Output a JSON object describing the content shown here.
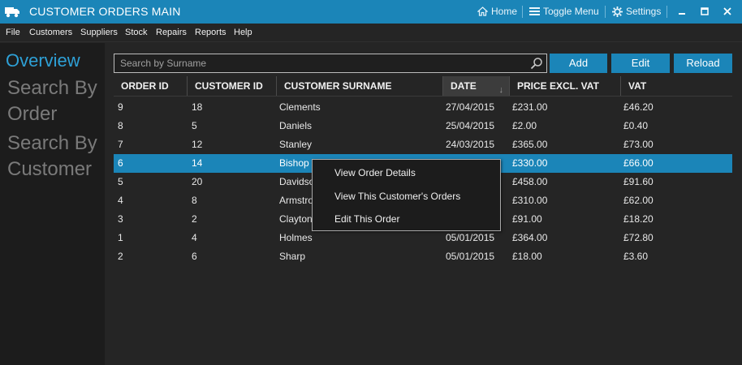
{
  "window": {
    "title": "CUSTOMER ORDERS MAIN",
    "home_label": "Home",
    "toggle_label": "Toggle Menu",
    "settings_label": "Settings"
  },
  "menu": [
    "File",
    "Customers",
    "Suppliers",
    "Stock",
    "Repairs",
    "Reports",
    "Help"
  ],
  "sidebar": {
    "overview": "Overview",
    "search_by_order": "Search By Order",
    "search_by_customer": "Search By Customer"
  },
  "search": {
    "placeholder": "Search by Surname",
    "value": ""
  },
  "buttons": {
    "add": "Add",
    "edit": "Edit",
    "reload": "Reload"
  },
  "table": {
    "columns": [
      "ORDER ID",
      "CUSTOMER ID",
      "CUSTOMER SURNAME",
      "DATE",
      "PRICE EXCL. VAT",
      "VAT"
    ],
    "sorted_column": "DATE",
    "sort_direction": "descending",
    "rows": [
      [
        "9",
        "18",
        "Clements",
        "27/04/2015",
        "£231.00",
        "£46.20"
      ],
      [
        "8",
        "5",
        "Daniels",
        "25/04/2015",
        "£2.00",
        "£0.40"
      ],
      [
        "7",
        "12",
        "Stanley",
        "24/03/2015",
        "£365.00",
        "£73.00"
      ],
      [
        "6",
        "14",
        "Bishop",
        "",
        "£330.00",
        "£66.00"
      ],
      [
        "5",
        "20",
        "Davidso",
        "",
        "£458.00",
        "£91.60"
      ],
      [
        "4",
        "8",
        "Armstro",
        "",
        "£310.00",
        "£62.00"
      ],
      [
        "3",
        "2",
        "Clayton",
        "",
        "£91.00",
        "£18.20"
      ],
      [
        "1",
        "4",
        "Holmes",
        "05/01/2015",
        "£364.00",
        "£72.80"
      ],
      [
        "2",
        "6",
        "Sharp",
        "05/01/2015",
        "£18.00",
        "£3.60"
      ]
    ],
    "selected_row_index": 3
  },
  "context_menu": {
    "items": [
      "View Order Details",
      "View This Customer's Orders",
      "Edit This Order"
    ]
  },
  "colors": {
    "accent": "#1b85b8",
    "background": "#252525",
    "sidebar": "#1c1c1c",
    "sidebar_active": "#2ea0d6",
    "sidebar_inactive": "#7a7a7a"
  }
}
